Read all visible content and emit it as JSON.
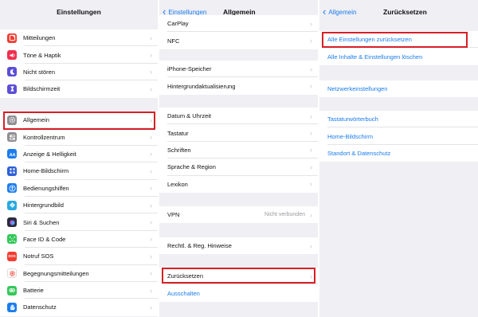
{
  "panel1": {
    "title": "Einstellungen",
    "group1": [
      {
        "label": "Mitteilungen",
        "icon": "notifications-icon",
        "color": "#f23b30"
      },
      {
        "label": "Töne & Haptik",
        "icon": "sound-icon",
        "color": "#f0304f"
      },
      {
        "label": "Nicht stören",
        "icon": "moon-icon",
        "color": "#5a4ed6"
      },
      {
        "label": "Bildschirmzeit",
        "icon": "hourglass-icon",
        "color": "#5a4ed6"
      }
    ],
    "group2": [
      {
        "label": "Allgemein",
        "icon": "gear-icon",
        "color": "#8e8e93"
      },
      {
        "label": "Kontrollzentrum",
        "icon": "toggles-icon",
        "color": "#8e8e93"
      },
      {
        "label": "Anzeige & Helligkeit",
        "icon": "text-size-icon",
        "color": "#1a7cf0"
      },
      {
        "label": "Home-Bildschirm",
        "icon": "grid-icon",
        "color": "#2c5fd8"
      },
      {
        "label": "Bedienungshilfen",
        "icon": "accessibility-icon",
        "color": "#1a7cf0"
      },
      {
        "label": "Hintergrundbild",
        "icon": "flower-icon",
        "color": "#28a9e0"
      },
      {
        "label": "Siri & Suchen",
        "icon": "siri-icon",
        "color": "#2a2a3a"
      },
      {
        "label": "Face ID & Code",
        "icon": "face-id-icon",
        "color": "#34c759"
      },
      {
        "label": "Notruf SOS",
        "icon": "sos-icon",
        "color": "#f23b30",
        "badge": "SOS"
      },
      {
        "label": "Begegnungsmitteilungen",
        "icon": "exposure-icon",
        "color": "#ffffff"
      },
      {
        "label": "Batterie",
        "icon": "battery-icon",
        "color": "#34c759"
      },
      {
        "label": "Datenschutz",
        "icon": "hand-icon",
        "color": "#1a7cf0"
      }
    ]
  },
  "panel2": {
    "back_label": "Einstellungen",
    "title": "Allgemein",
    "group1": [
      "CarPlay",
      "NFC"
    ],
    "group2": [
      "iPhone-Speicher",
      "Hintergrundaktualisierung"
    ],
    "group3": [
      "Datum & Uhrzeit",
      "Tastatur",
      "Schriften",
      "Sprache & Region",
      "Lexikon"
    ],
    "vpn": {
      "label": "VPN",
      "detail": "Nicht verbunden"
    },
    "group5": [
      "Rechtl. & Reg. Hinweise"
    ],
    "reset_label": "Zurücksetzen",
    "shutdown_label": "Ausschalten"
  },
  "panel3": {
    "back_label": "Allgemein",
    "title": "Zurücksetzen",
    "group1": [
      "Alle Einstellungen zurücksetzen",
      "Alle Inhalte & Einstellungen löschen"
    ],
    "group2": [
      "Netzwerkeinstellungen"
    ],
    "group3": [
      "Tastaturwörterbuch",
      "Home-Bildschirm",
      "Standort & Datenschutz"
    ]
  },
  "colors": {
    "accent": "#1a7cf0",
    "highlight": "#d61f26",
    "background": "#efeff4"
  }
}
